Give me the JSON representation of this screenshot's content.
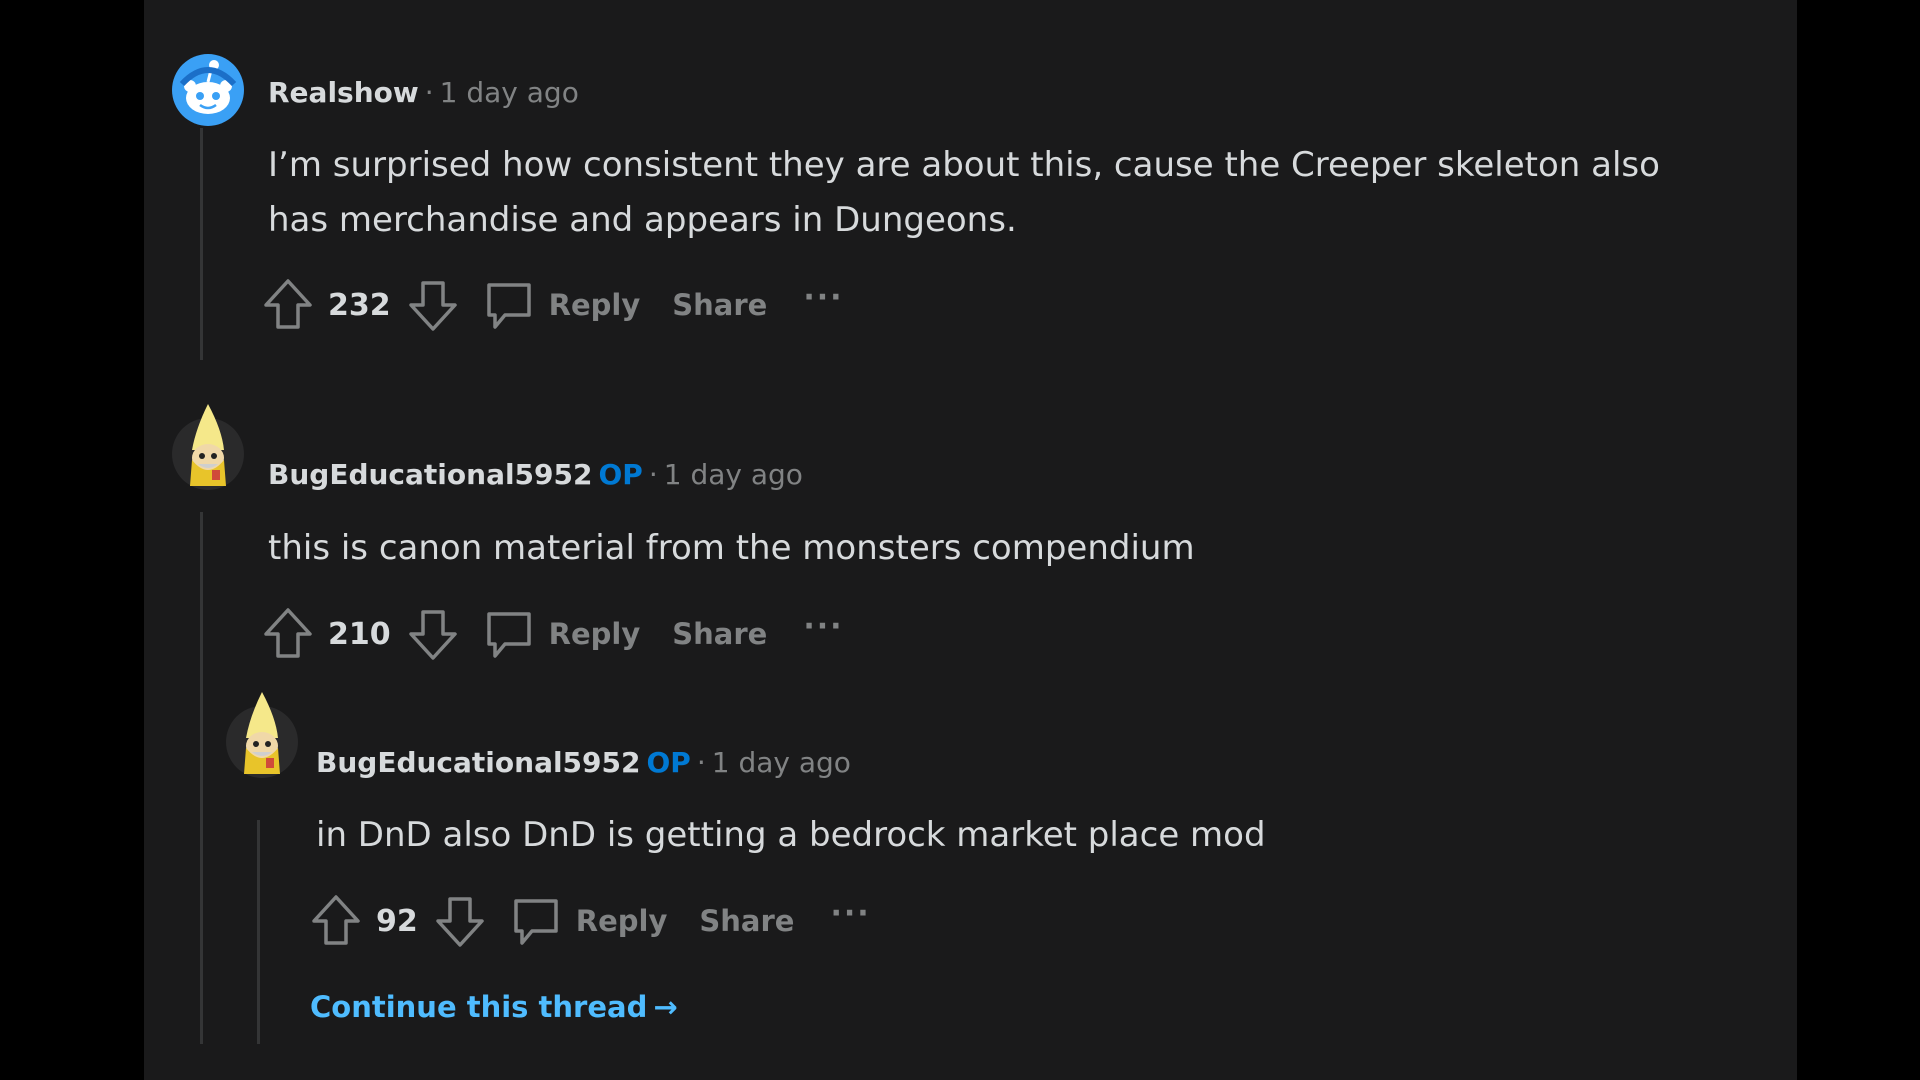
{
  "comments": [
    {
      "author": "Realshow",
      "op_badge": "",
      "separator": "·",
      "time": "1 day ago",
      "lines": [
        "I’m surprised how consistent they are about this, cause the Creeper skeleton also",
        "has merchandise and appears in Dungeons."
      ],
      "score": "232",
      "reply_label": "Reply",
      "share_label": "Share",
      "more_label": "···",
      "avatar_icon": "reddit-snoo-avatar-icon"
    },
    {
      "author": "BugEducational5952",
      "op_badge": "OP",
      "separator": "·",
      "time": "1 day ago",
      "lines": [
        "this is canon material from the monsters compendium"
      ],
      "score": "210",
      "reply_label": "Reply",
      "share_label": "Share",
      "more_label": "···",
      "avatar_icon": "banana-wizard-avatar-icon"
    },
    {
      "author": "BugEducational5952",
      "op_badge": "OP",
      "separator": "·",
      "time": "1 day ago",
      "lines": [
        "in DnD also DnD is getting a bedrock market place mod"
      ],
      "score": "92",
      "reply_label": "Reply",
      "share_label": "Share",
      "more_label": "···",
      "avatar_icon": "banana-wizard-avatar-icon"
    }
  ],
  "continue_thread": {
    "label": "Continue this thread",
    "arrow": "→"
  },
  "colors": {
    "background": "#1a1a1b",
    "outer": "#000000",
    "text": "#d7dadc",
    "muted": "#818384",
    "op": "#0079d3",
    "link": "#4fbcff"
  }
}
